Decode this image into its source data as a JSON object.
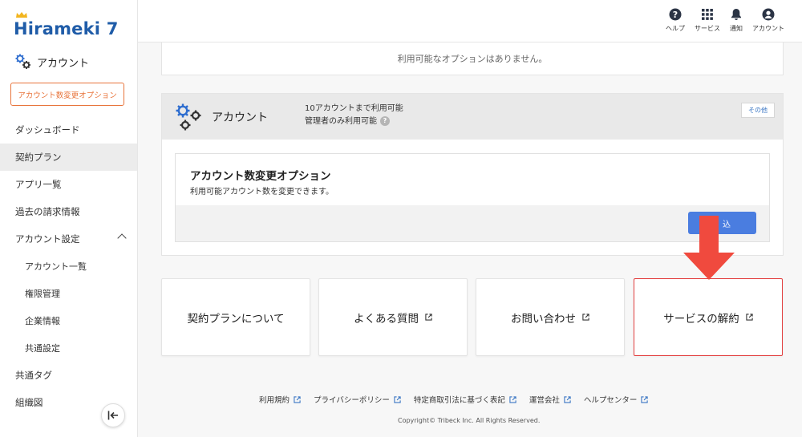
{
  "brand": {
    "logo_text": "Hirameki 7",
    "accent": "#1f5ca8",
    "option_color": "#e8743b"
  },
  "sidebar": {
    "account_heading": "アカウント",
    "option_button": "アカウント数変更オプション",
    "items": [
      {
        "label": "ダッシュボード"
      },
      {
        "label": "契約プラン"
      },
      {
        "label": "アプリ一覧"
      },
      {
        "label": "過去の請求情報"
      },
      {
        "label": "アカウント設定"
      },
      {
        "label": "アカウント一覧"
      },
      {
        "label": "権限管理"
      },
      {
        "label": "企業情報"
      },
      {
        "label": "共通設定"
      },
      {
        "label": "共通タグ"
      },
      {
        "label": "組織図"
      }
    ]
  },
  "header": {
    "icons": [
      {
        "icon": "help-icon",
        "label": "ヘルプ"
      },
      {
        "icon": "grid-icon",
        "label": "サービス"
      },
      {
        "icon": "bell-icon",
        "label": "通知"
      },
      {
        "icon": "user-icon",
        "label": "アカウント"
      }
    ]
  },
  "main": {
    "no_options_text": "利用可能なオプションはありません。",
    "account_card": {
      "title": "アカウント",
      "info_line1": "10アカウントまで利用可能",
      "info_line2": "管理者のみ利用可能",
      "help_mark": "?",
      "badge": "その他",
      "option_title": "アカウント数変更オプション",
      "option_desc": "利用可能アカウント数を変更できます。",
      "apply_label": "込"
    },
    "tiles": [
      {
        "label": "契約プランについて",
        "external": false
      },
      {
        "label": "よくある質問",
        "external": true
      },
      {
        "label": "お問い合わせ",
        "external": true
      },
      {
        "label": "サービスの解約",
        "external": true
      }
    ]
  },
  "footer": {
    "links": [
      "利用規約",
      "プライバシーポリシー",
      "特定商取引法に基づく表記",
      "運営会社",
      "ヘルプセンター"
    ],
    "copyright": "Copyright© Tribeck Inc. All Rights Reserved."
  },
  "annotation": {
    "arrow_color": "#f04a3e",
    "highlight_color": "#e34040"
  }
}
